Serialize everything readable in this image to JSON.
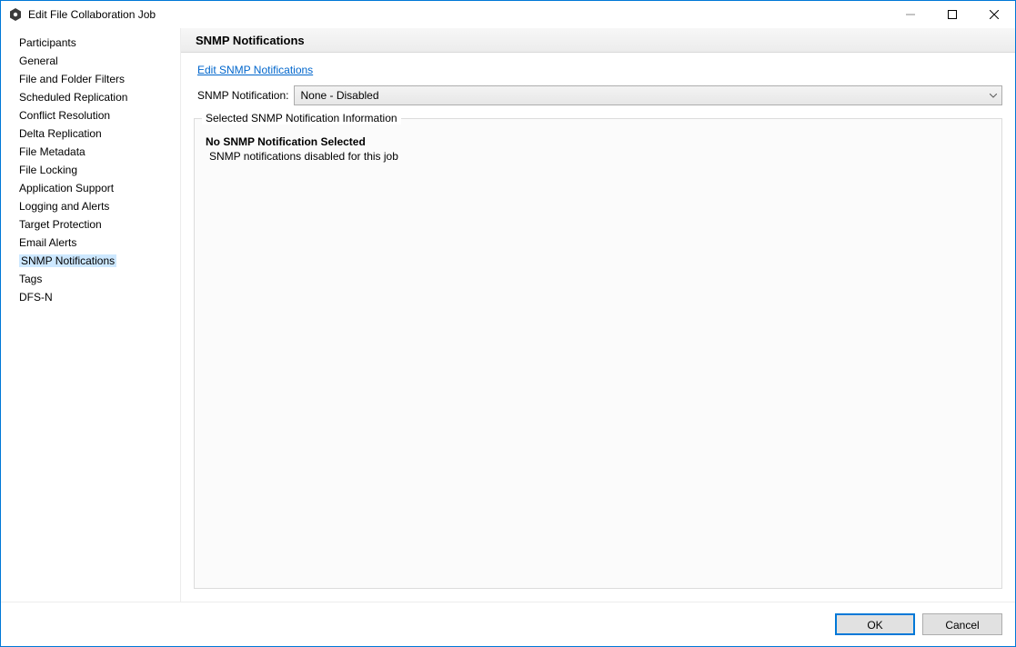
{
  "window": {
    "title": "Edit File Collaboration Job"
  },
  "sidebar": {
    "items": [
      {
        "label": "Participants",
        "selected": false
      },
      {
        "label": "General",
        "selected": false
      },
      {
        "label": "File and Folder Filters",
        "selected": false
      },
      {
        "label": "Scheduled Replication",
        "selected": false
      },
      {
        "label": "Conflict Resolution",
        "selected": false
      },
      {
        "label": "Delta Replication",
        "selected": false
      },
      {
        "label": "File Metadata",
        "selected": false
      },
      {
        "label": "File Locking",
        "selected": false
      },
      {
        "label": "Application Support",
        "selected": false
      },
      {
        "label": "Logging and Alerts",
        "selected": false
      },
      {
        "label": "Target Protection",
        "selected": false
      },
      {
        "label": "Email Alerts",
        "selected": false
      },
      {
        "label": "SNMP Notifications",
        "selected": true
      },
      {
        "label": "Tags",
        "selected": false
      },
      {
        "label": "DFS-N",
        "selected": false
      }
    ]
  },
  "main": {
    "header": "SNMP Notifications",
    "edit_link": "Edit SNMP Notifications",
    "notification_label": "SNMP Notification:",
    "notification_value": "None - Disabled",
    "group_legend": "Selected SNMP Notification Information",
    "info_title": "No SNMP Notification Selected",
    "info_text": "SNMP notifications disabled for this job"
  },
  "footer": {
    "ok": "OK",
    "cancel": "Cancel"
  }
}
